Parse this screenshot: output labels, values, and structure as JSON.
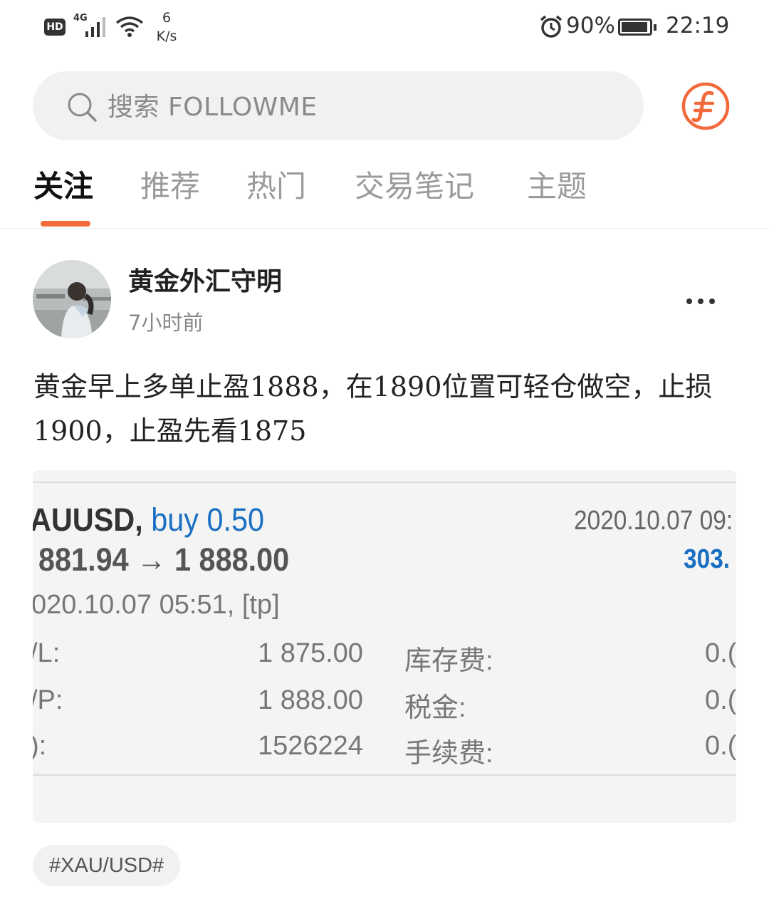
{
  "status_bar": {
    "hd": "HD",
    "network": "4G",
    "speed_value": "6",
    "speed_unit": "K/s",
    "battery_percent": "90%",
    "time": "22:19"
  },
  "search": {
    "placeholder": "搜索 FOLLOWME",
    "icon": "search-icon"
  },
  "tabs": [
    {
      "label": "关注",
      "active": true
    },
    {
      "label": "推荐",
      "active": false
    },
    {
      "label": "热门",
      "active": false
    },
    {
      "label": "交易笔记",
      "active": false
    },
    {
      "label": "主题",
      "active": false
    }
  ],
  "post": {
    "author": "黄金外汇守明",
    "time": "7小时前",
    "content": "黄金早上多单止盈1888，在1890位置可轻仓做空，止损1900，止盈先看1875",
    "tag": "#XAU/USD#",
    "trade": {
      "symbol": "AUUSD,",
      "side": "buy",
      "lots": "0.50",
      "prices": "881.94 → 1 888.00",
      "open_time": "2020.10.07 09:",
      "profit": "303.",
      "close_info": "020.10.07 05:51, [tp]",
      "rows": [
        {
          "label": "/L:",
          "value": "1 875.00",
          "label2": "库存费:",
          "value2": "0.("
        },
        {
          "label": "/P:",
          "value": "1 888.00",
          "label2": "税金:",
          "value2": "0.("
        },
        {
          "label": "):",
          "value": "1526224",
          "label2": "手续费:",
          "value2": "0.("
        }
      ]
    }
  },
  "colors": {
    "accent": "#f26a3c",
    "trade_blue": "#1a6fc2"
  }
}
